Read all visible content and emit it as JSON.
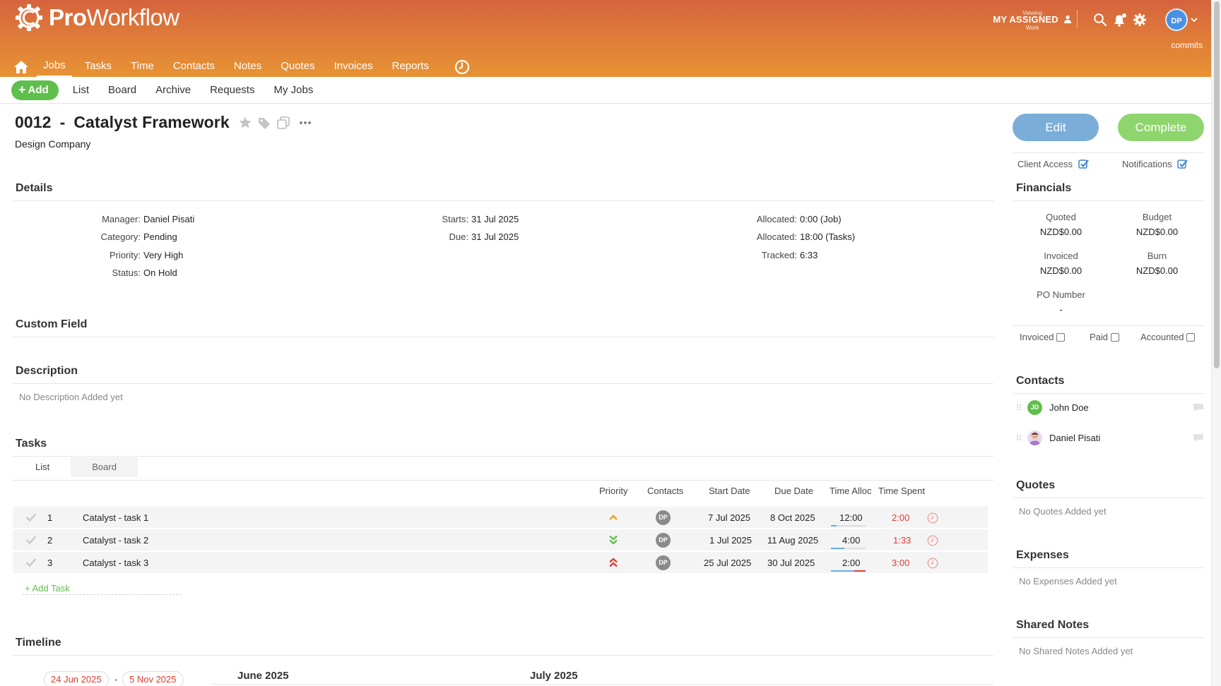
{
  "app": {
    "brand_bold": "Pro",
    "brand_rest": "Workflow",
    "viewing_top": "Viewing",
    "viewing_main": "MY ASSIGNED",
    "viewing_bottom": "Work",
    "user_initials": "DP",
    "commits": "commits",
    "brand_color": "#e07f38"
  },
  "nav": {
    "items": [
      "Jobs",
      "Tasks",
      "Time",
      "Contacts",
      "Notes",
      "Quotes",
      "Invoices",
      "Reports"
    ],
    "active": "Jobs"
  },
  "subnav": {
    "add": "Add",
    "tabs": [
      "List",
      "Board",
      "Archive",
      "Requests",
      "My Jobs"
    ]
  },
  "job": {
    "number": "0012",
    "sep": "-",
    "name": "Catalyst Framework",
    "company": "Design Company"
  },
  "details": {
    "heading": "Details",
    "manager_k": "Manager:",
    "manager_v": "Daniel Pisati",
    "category_k": "Category:",
    "category_v": "Pending",
    "priority_k": "Priority:",
    "priority_v": "Very High",
    "status_k": "Status:",
    "status_v": "On Hold",
    "starts_k": "Starts:",
    "starts_v": "31 Jul 2025",
    "due_k": "Due:",
    "due_v": "31 Jul 2025",
    "alloc_job_k": "Allocated:",
    "alloc_job_v": "0:00 (Job)",
    "alloc_tasks_k": "Allocated:",
    "alloc_tasks_v": "18:00 (Tasks)",
    "tracked_k": "Tracked:",
    "tracked_v": "6:33"
  },
  "custom_field": {
    "heading": "Custom Field"
  },
  "description": {
    "heading": "Description",
    "empty": "No Description Added yet"
  },
  "tasks": {
    "heading": "Tasks",
    "tabs": [
      "List",
      "Board"
    ],
    "columns": [
      "Priority",
      "Contacts",
      "Start Date",
      "Due Date",
      "Time Alloc",
      "Time Spent"
    ],
    "rows": [
      {
        "num": "1",
        "name": "Catalyst - task 1",
        "priority": "up-icon",
        "contact": "DP",
        "start": "7 Jul 2025",
        "due": "8 Oct 2025",
        "alloc": "12:00",
        "spent": "2:00",
        "alloc_fill": 0.17,
        "over": false
      },
      {
        "num": "2",
        "name": "Catalyst - task 2",
        "priority": "double-down-icon",
        "contact": "DP",
        "start": "1 Jul 2025",
        "due": "11 Aug 2025",
        "alloc": "4:00",
        "spent": "1:33",
        "alloc_fill": 0.39,
        "over": false
      },
      {
        "num": "3",
        "name": "Catalyst - task 3",
        "priority": "double-up-icon",
        "contact": "DP",
        "start": "25 Jul 2025",
        "due": "30 Jul 2025",
        "alloc": "2:00",
        "spent": "3:00",
        "alloc_fill": 0.67,
        "over": true
      }
    ],
    "add_task": "+ Add Task",
    "priority_colors": {
      "up": "#f0a020",
      "down": "#5fbf4c",
      "double_up": "#e03c31"
    }
  },
  "timeline": {
    "heading": "Timeline",
    "start": "24 Jun 2025",
    "dash": "-",
    "end": "5 Nov 2025",
    "months": [
      "June 2025",
      "July 2025"
    ]
  },
  "sidebar": {
    "edit": "Edit",
    "complete": "Complete",
    "client_access": "Client Access",
    "notifications": "Notifications",
    "financials": {
      "heading": "Financials",
      "quoted_k": "Quoted",
      "quoted_v": "NZD$0.00",
      "budget_k": "Budget",
      "budget_v": "NZD$0.00",
      "invoiced_k": "Invoiced",
      "invoiced_v": "NZD$0.00",
      "burn_k": "Burn",
      "burn_v": "NZD$0.00",
      "po_k": "PO Number",
      "po_v": "-",
      "invoiced_chk": "Invoiced",
      "paid_chk": "Paid",
      "accounted_chk": "Accounted"
    },
    "contacts": {
      "heading": "Contacts",
      "items": [
        {
          "initials": "JD",
          "name": "John Doe"
        },
        {
          "initials": "",
          "name": "Daniel Pisati"
        }
      ]
    },
    "quotes": {
      "heading": "Quotes",
      "empty": "No Quotes Added yet"
    },
    "expenses": {
      "heading": "Expenses",
      "empty": "No Expenses Added yet"
    },
    "shared_notes": {
      "heading": "Shared Notes",
      "empty": "No Shared Notes Added yet"
    }
  }
}
